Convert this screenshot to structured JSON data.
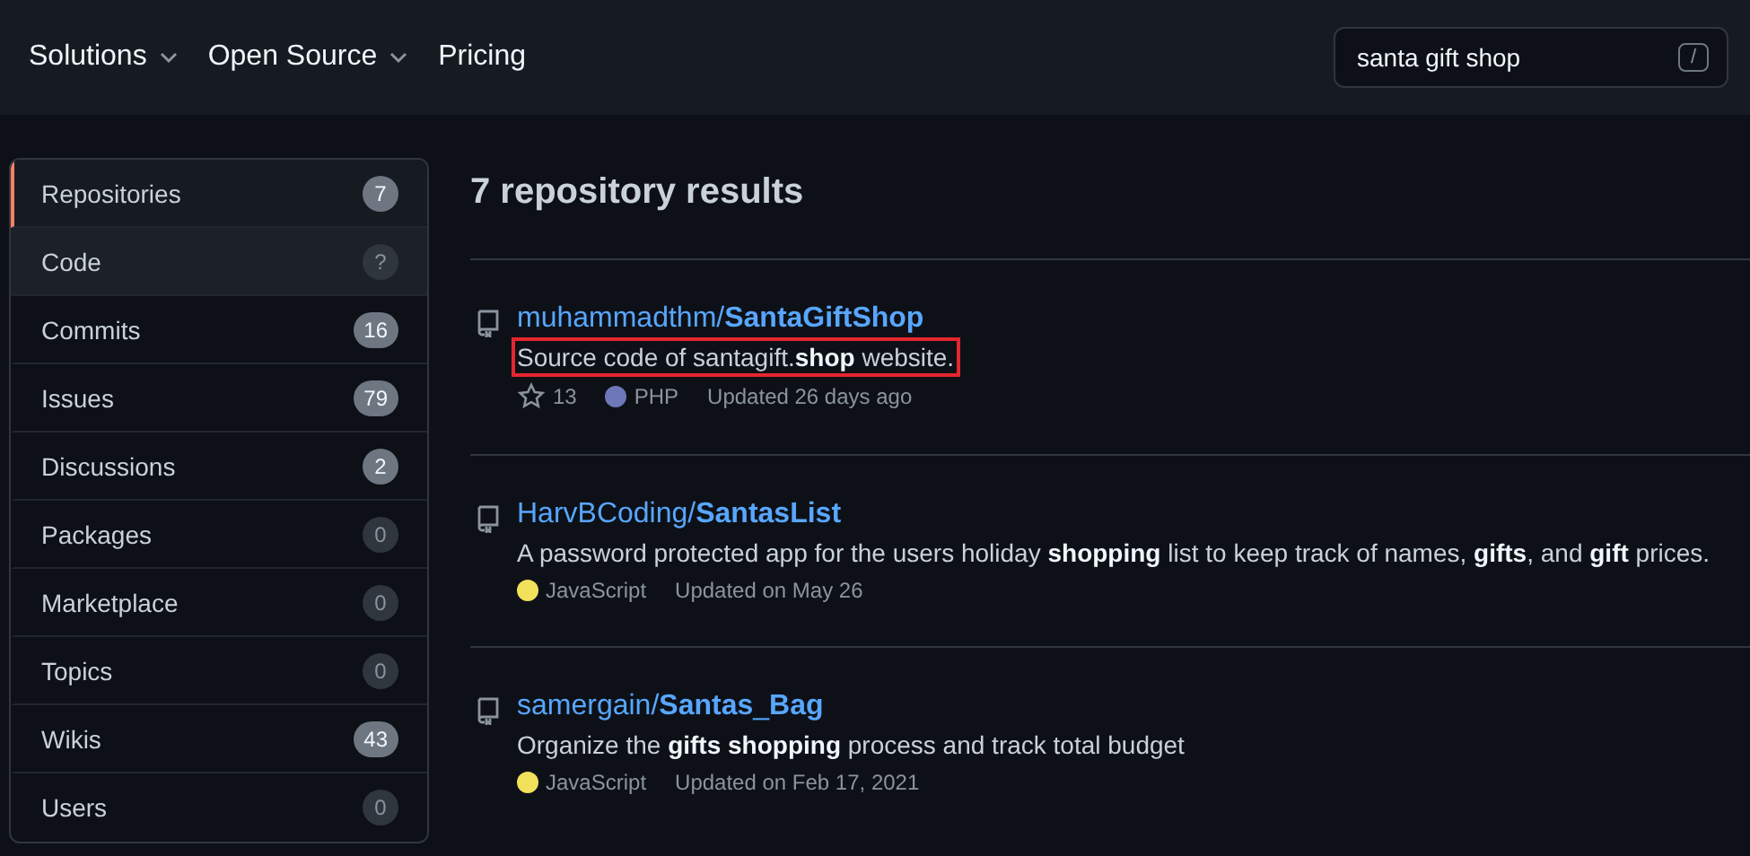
{
  "header": {
    "nav": [
      {
        "label": "Solutions",
        "dropdown": true
      },
      {
        "label": "Open Source",
        "dropdown": true
      },
      {
        "label": "Pricing",
        "dropdown": false
      }
    ],
    "search": {
      "value": "santa gift shop",
      "shortcut": "/"
    }
  },
  "sidebar": {
    "items": [
      {
        "label": "Repositories",
        "count": "7",
        "selected": true,
        "muted": false,
        "hovered": false
      },
      {
        "label": "Code",
        "count": "?",
        "selected": false,
        "muted": true,
        "hovered": true
      },
      {
        "label": "Commits",
        "count": "16",
        "selected": false,
        "muted": false,
        "hovered": false
      },
      {
        "label": "Issues",
        "count": "79",
        "selected": false,
        "muted": false,
        "hovered": false
      },
      {
        "label": "Discussions",
        "count": "2",
        "selected": false,
        "muted": false,
        "hovered": false
      },
      {
        "label": "Packages",
        "count": "0",
        "selected": false,
        "muted": true,
        "hovered": false
      },
      {
        "label": "Marketplace",
        "count": "0",
        "selected": false,
        "muted": true,
        "hovered": false
      },
      {
        "label": "Topics",
        "count": "0",
        "selected": false,
        "muted": true,
        "hovered": false
      },
      {
        "label": "Wikis",
        "count": "43",
        "selected": false,
        "muted": false,
        "hovered": false
      },
      {
        "label": "Users",
        "count": "0",
        "selected": false,
        "muted": true,
        "hovered": false
      }
    ]
  },
  "results": {
    "title": "7 repository results",
    "items": [
      {
        "name": "muhammadthm/**SantaGiftShop**",
        "description": "Source code of santagift.**shop** website.",
        "highlighted": true,
        "stars": "13",
        "language": "PHP",
        "color": "#6e77b8",
        "updated": "Updated 26 days ago"
      },
      {
        "name": "HarvBCoding/**SantasList**",
        "description": "A password protected app for the users holiday **shopping** list to keep track of names, **gifts**, and **gift** prices.",
        "highlighted": false,
        "language": "JavaScript",
        "color": "#f1e05a",
        "updated": "Updated on May 26"
      },
      {
        "name": "samergain/**Santas**_**Bag**",
        "description": "Organize the **gifts shopping** process and track total budget",
        "highlighted": false,
        "language": "JavaScript",
        "color": "#f1e05a",
        "updated": "Updated on Feb 17, 2021"
      }
    ]
  }
}
